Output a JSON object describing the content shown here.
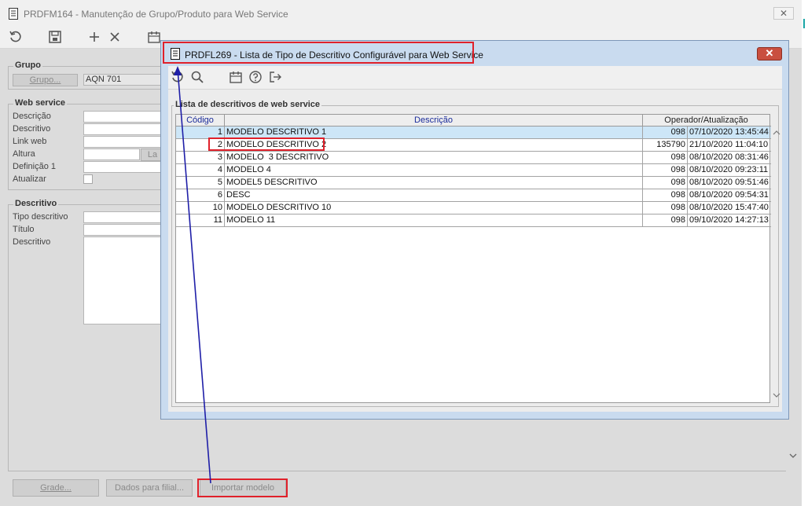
{
  "main_window": {
    "title": "PRDFM164 - Manutenção de Grupo/Produto para Web Service",
    "close_label": "✕"
  },
  "grupo": {
    "title": "Grupo",
    "button_label": "Grupo...",
    "value": "AQN 701"
  },
  "web_service": {
    "title": "Web service",
    "labels": [
      "Descrição",
      "Descritivo",
      "Link web",
      "Altura",
      "Definição 1",
      "Atualizar"
    ],
    "altura_button": "La"
  },
  "descritivo": {
    "title": "Descritivo",
    "labels": [
      "Tipo descritivo",
      "Título",
      "Descritivo"
    ]
  },
  "bottom_buttons": {
    "grade": "Grade...",
    "dados_filial": "Dados para filial...",
    "importar": "Importar modelo"
  },
  "dialog": {
    "title": "PRDFL269 - Lista de Tipo de Descritivo Configurável para Web Service",
    "close_label": "✕",
    "list_title": "Lista de descritivos de web service",
    "columns": [
      "Código",
      "Descrição",
      "Operador/Atualização"
    ],
    "rows": [
      {
        "code": "1",
        "desc": "MODELO DESCRITIVO 1",
        "op": "098",
        "date": "07/10/2020 13:45:44"
      },
      {
        "code": "2",
        "desc": "MODELO DESCRITIVO 2",
        "op": "135790",
        "date": "21/10/2020 11:04:10"
      },
      {
        "code": "3",
        "desc": "MODELO  3 DESCRITIVO",
        "op": "098",
        "date": "08/10/2020 08:31:46"
      },
      {
        "code": "4",
        "desc": "MODELO 4",
        "op": "098",
        "date": "08/10/2020 09:23:11"
      },
      {
        "code": "5",
        "desc": "MODEL5 DESCRITIVO",
        "op": "098",
        "date": "08/10/2020 09:51:46"
      },
      {
        "code": "6",
        "desc": "DESC",
        "op": "098",
        "date": "08/10/2020 09:54:31"
      },
      {
        "code": "10",
        "desc": "MODELO DESCRITIVO 10",
        "op": "098",
        "date": "08/10/2020 15:47:40"
      },
      {
        "code": "11",
        "desc": "MODELO 11",
        "op": "098",
        "date": "09/10/2020 14:27:13"
      }
    ]
  },
  "colors": {
    "highlight": "#e0212b",
    "arrow": "#1f1fa8",
    "dialog_frame": "#c9dbef",
    "selected_row": "#cde6f7"
  }
}
